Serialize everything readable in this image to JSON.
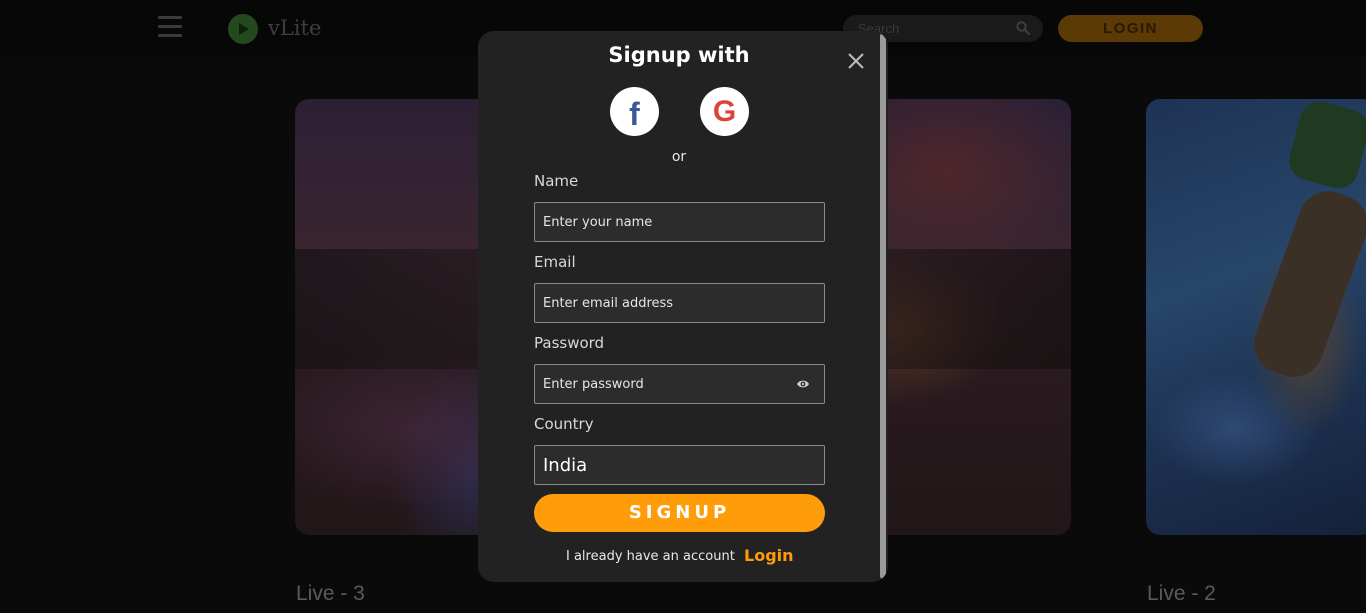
{
  "header": {
    "logo_text": "vLite",
    "search": {
      "placeholder": "Search"
    },
    "login_label": "LOGIN"
  },
  "cards": [
    {
      "caption": "Live - 3"
    },
    {
      "caption": "Live - 2"
    }
  ],
  "modal": {
    "title": "Signup with",
    "social": {
      "facebook_glyph": "f",
      "google_glyph": "G"
    },
    "divider": "or",
    "fields": {
      "name": {
        "label": "Name",
        "placeholder": "Enter your name"
      },
      "email": {
        "label": "Email",
        "placeholder": "Enter email address"
      },
      "password": {
        "label": "Password",
        "placeholder": "Enter password"
      },
      "country": {
        "label": "Country",
        "value": "India"
      }
    },
    "signup_label": "SIGNUP",
    "footer": {
      "text": "I already have an account",
      "link": "Login"
    }
  },
  "colors": {
    "accent": "#fe9c09",
    "modal_bg": "#222223",
    "facebook": "#3b5998",
    "google": "#db4437"
  },
  "icons": [
    "menu-icon",
    "logo-play-icon",
    "search-icon",
    "close-icon",
    "facebook-icon",
    "google-icon",
    "eye-icon"
  ]
}
